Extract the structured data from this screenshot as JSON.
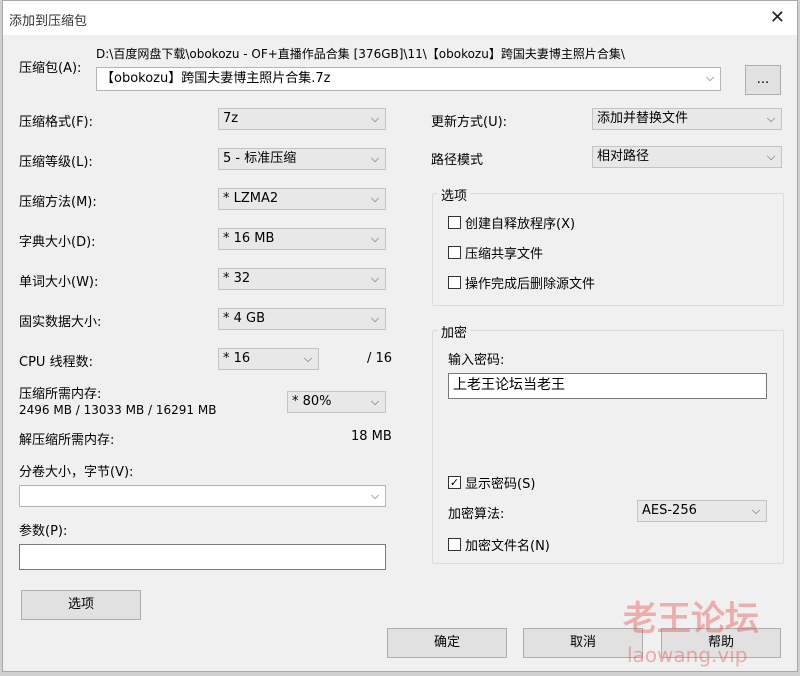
{
  "window": {
    "title": "添加到压缩包"
  },
  "archive": {
    "label": "压缩包(A):",
    "path": "D:\\百度网盘下载\\obokozu - OF+直播作品合集 [376GB]\\11\\【obokozu】跨国夫妻博主照片合集\\",
    "filename": "【obokozu】跨国夫妻博主照片合集.7z",
    "browse_label": "..."
  },
  "left": {
    "format": {
      "label": "压缩格式(F):",
      "value": "7z"
    },
    "level": {
      "label": "压缩等级(L):",
      "value": "5 - 标准压缩"
    },
    "method": {
      "label": "压缩方法(M):",
      "value": "* LZMA2"
    },
    "dict": {
      "label": "字典大小(D):",
      "value": "* 16 MB"
    },
    "word": {
      "label": "单词大小(W):",
      "value": "* 32"
    },
    "solid": {
      "label": "固实数据大小:",
      "value": "* 4 GB"
    },
    "threads": {
      "label": "CPU 线程数:",
      "value": "* 16",
      "total": "/ 16"
    },
    "mem_compress": {
      "label": "压缩所需内存:",
      "value": "2496 MB / 13033 MB / 16291 MB",
      "percent": "* 80%"
    },
    "mem_decompress": {
      "label": "解压缩所需内存:",
      "value": "18 MB"
    },
    "volume": {
      "label": "分卷大小，字节(V):",
      "value": ""
    },
    "params": {
      "label": "参数(P):",
      "value": ""
    },
    "options_button": "选项"
  },
  "right": {
    "update": {
      "label": "更新方式(U):",
      "value": "添加并替换文件"
    },
    "pathmode": {
      "label": "路径模式",
      "value": "相对路径"
    },
    "options_group": {
      "title": "选项",
      "sfx": {
        "label": "创建自释放程序(X)",
        "checked": false
      },
      "shared": {
        "label": "压缩共享文件",
        "checked": false
      },
      "delete": {
        "label": "操作完成后删除源文件",
        "checked": false
      }
    },
    "encryption": {
      "title": "加密",
      "password_label": "输入密码:",
      "password_value": "上老王论坛当老王",
      "show_password": {
        "label": "显示密码(S)",
        "checked": true,
        "mark": "✓"
      },
      "method": {
        "label": "加密算法:",
        "value": "AES-256"
      },
      "encrypt_names": {
        "label": "加密文件名(N)",
        "checked": false
      }
    }
  },
  "buttons": {
    "ok": "确定",
    "cancel": "取消",
    "help": "帮助"
  },
  "watermark": {
    "text1": "老王论坛",
    "text2": "laowang.vip"
  }
}
